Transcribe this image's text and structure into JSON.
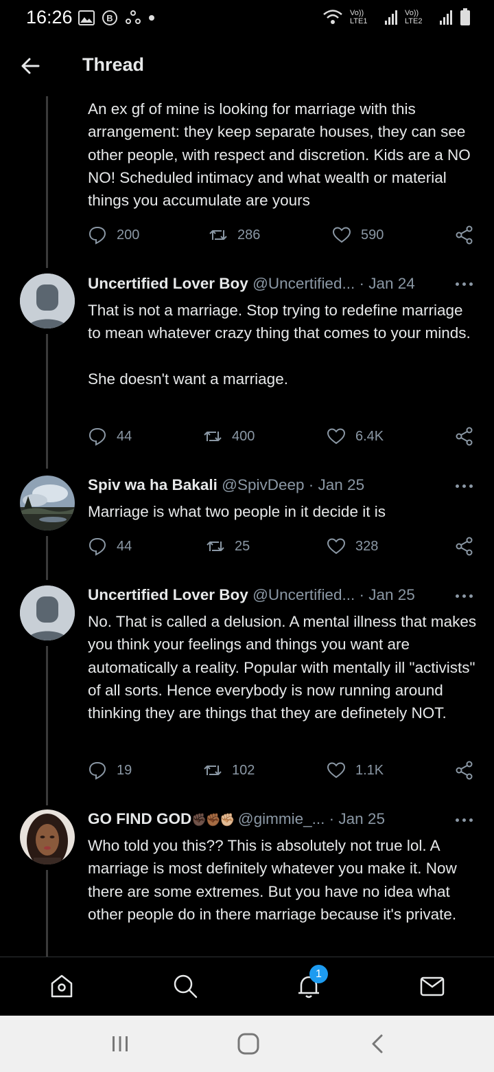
{
  "status_bar": {
    "time": "16:26",
    "signal1_label": "Vo)) LTE1",
    "signal2_label": "Vo)) LTE2"
  },
  "header": {
    "title": "Thread"
  },
  "colors": {
    "background": "#000000",
    "text": "#e7e9ea",
    "muted": "#8b98a5",
    "accent": "#1d9bf0"
  },
  "tweets": [
    {
      "text": "An ex gf of mine is looking for marriage with this arrangement: they keep separate houses, they can see other people, with respect and discretion. Kids are a NO NO! Scheduled intimacy and what wealth or material things you accumulate are yours",
      "replies": "200",
      "retweets": "286",
      "likes": "590"
    },
    {
      "name": "Uncertified Lover Boy",
      "handle": "@Uncertified...",
      "date": "· Jan 24",
      "text": "That is not a marriage. Stop trying to redefine marriage to mean whatever crazy thing that comes to your minds.\n\nShe doesn't want a marriage.",
      "replies": "44",
      "retweets": "400",
      "likes": "6.4K"
    },
    {
      "name": "Spiv wa ha Bakali",
      "handle": "@SpivDeep",
      "date": "· Jan 25",
      "text": "Marriage is what two people in it decide it is",
      "replies": "44",
      "retweets": "25",
      "likes": "328"
    },
    {
      "name": "Uncertified Lover Boy",
      "handle": "@Uncertified...",
      "date": "· Jan 25",
      "text": "No. That is called a delusion. A mental illness that makes you think your feelings and things you want are automatically a reality. Popular with mentally ill \"activists\" of all sorts. Hence everybody is now running around thinking they are things that they are definetely NOT.",
      "replies": "19",
      "retweets": "102",
      "likes": "1.1K"
    },
    {
      "name": "GO FIND GOD",
      "name_emoji": "✊🏿✊🏾✊🏼",
      "handle": "@gimmie_...",
      "date": "· Jan 25",
      "text": "Who told you this?? This is absolutely not true lol. A marriage is most definitely whatever you make it. Now there are some extremes. But you have no idea what other people do in there marriage because it's private."
    }
  ],
  "bottom_nav": {
    "notification_count": "1"
  }
}
